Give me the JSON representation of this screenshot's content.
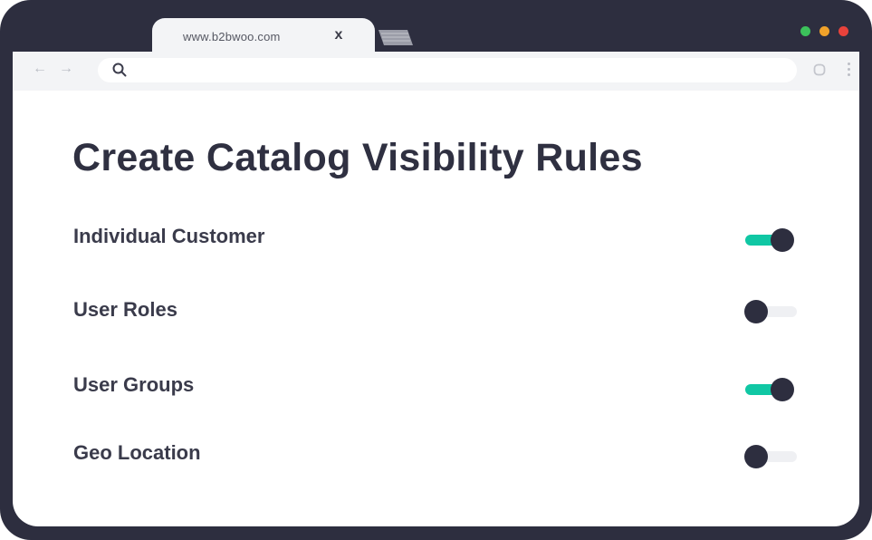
{
  "browser": {
    "tab": {
      "url": "www.b2bwoo.com",
      "close_label": "x"
    },
    "window_dots": [
      "#3cc25b",
      "#f0a22a",
      "#e8423b"
    ]
  },
  "page": {
    "title": "Create Catalog Visibility Rules",
    "rules": [
      {
        "label": "Individual Customer",
        "enabled": true
      },
      {
        "label": "User Roles",
        "enabled": false
      },
      {
        "label": "User Groups",
        "enabled": true
      },
      {
        "label": "Geo Location",
        "enabled": false
      }
    ]
  },
  "colors": {
    "frame": "#2d2e3f",
    "toggle_on": "#10c7a4",
    "toggle_off": "#eff0f3"
  },
  "icons": {
    "back": "arrow-left-icon",
    "forward": "arrow-right-icon",
    "search": "search-icon",
    "reload": "reload-icon",
    "menu": "kebab-menu-icon"
  }
}
